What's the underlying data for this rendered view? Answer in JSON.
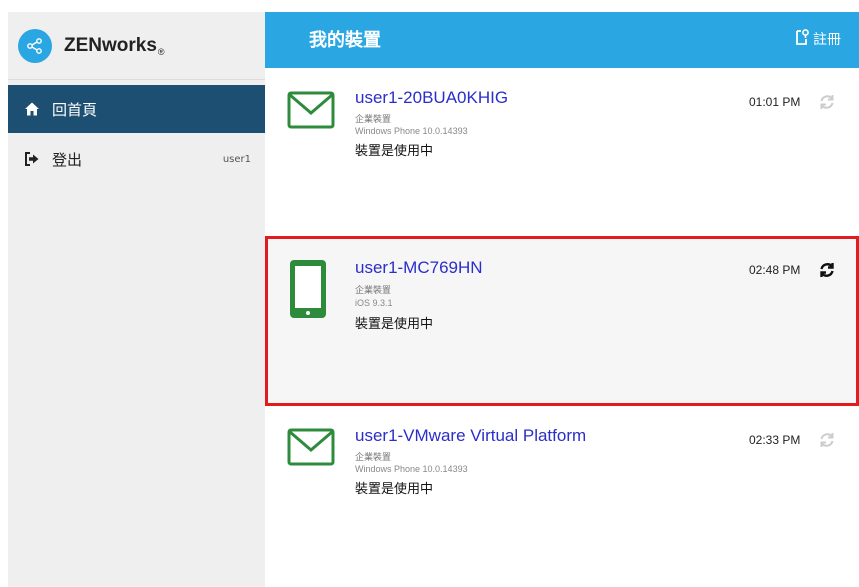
{
  "app": {
    "brand": "ZENworks",
    "brand_mark": "®"
  },
  "sidebar": {
    "items": [
      {
        "label": "回首頁",
        "icon": "home-icon"
      },
      {
        "label": "登出",
        "icon": "sign-out-icon",
        "user": "user1"
      }
    ]
  },
  "header": {
    "title": "我的裝置",
    "register_label": "註冊",
    "register_icon": "register-icon"
  },
  "devices": [
    {
      "name": "user1-20BUA0KHIG",
      "type": "企業裝置",
      "os": "Windows Phone 10.0.14393",
      "status": "裝置是使用中",
      "time": "01:01 PM",
      "icon": "envelope-icon"
    },
    {
      "name": "user1-MC769HN",
      "type": "企業裝置",
      "os": "iOS 9.3.1",
      "status": "裝置是使用中",
      "time": "02:48 PM",
      "icon": "tablet-icon"
    },
    {
      "name": "user1-VMware Virtual Platform",
      "type": "企業裝置",
      "os": "Windows Phone 10.0.14393",
      "status": "裝置是使用中",
      "time": "02:33 PM",
      "icon": "envelope-icon"
    }
  ],
  "colors": {
    "accent": "#2aa7e2",
    "nav_active": "#1d4f72",
    "device_icon": "#2e8b3c",
    "device_name": "#2b2ec8",
    "highlight": "#e11c1c"
  }
}
